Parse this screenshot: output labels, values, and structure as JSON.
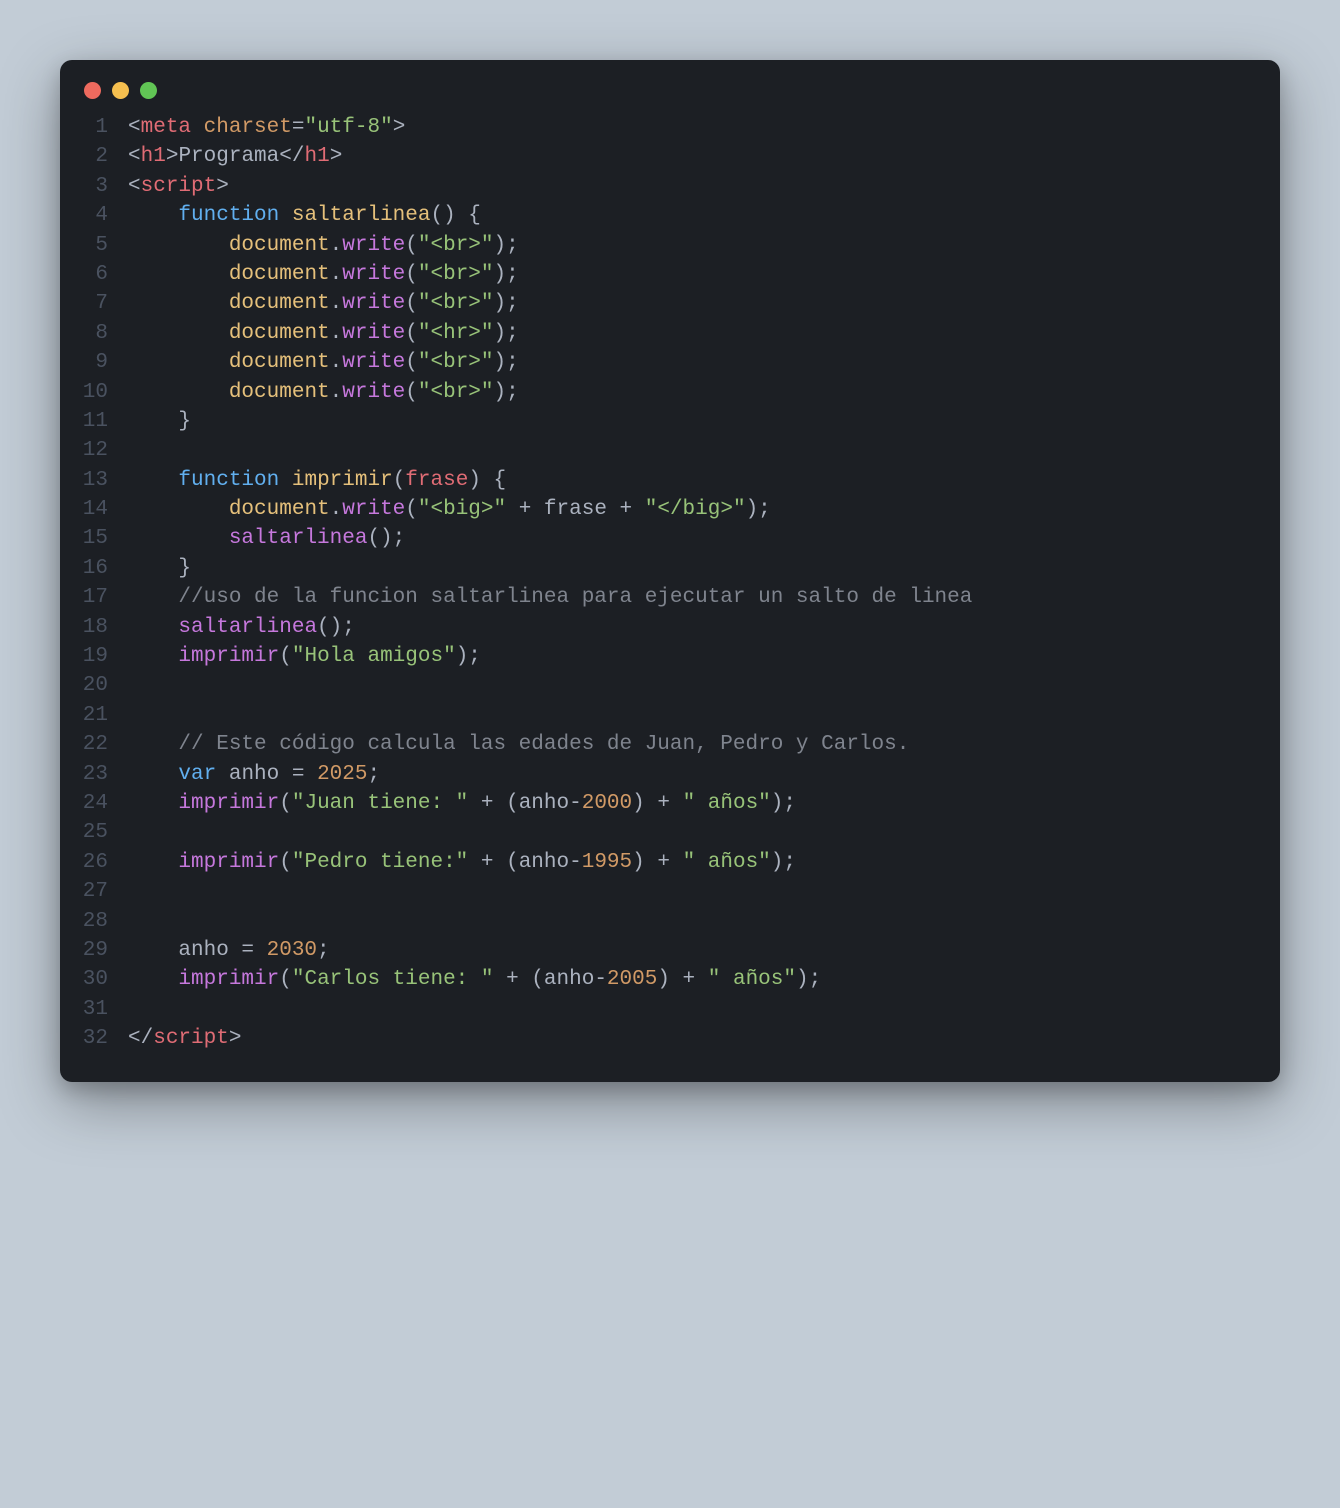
{
  "window": {
    "dots": [
      "red",
      "yellow",
      "green"
    ]
  },
  "colors": {
    "bg": "#1c1f24",
    "gutter": "#4a5260",
    "default": "#abb2bf",
    "tag": "#e06c75",
    "attr": "#d19a66",
    "string": "#98c379",
    "keyword": "#61afef",
    "func": "#e5c07b",
    "call": "#c678dd",
    "number": "#d19a66",
    "comment": "#7f848e"
  },
  "code": {
    "lines": [
      {
        "n": 1,
        "tokens": [
          {
            "t": "<",
            "c": "punc"
          },
          {
            "t": "meta",
            "c": "tag"
          },
          {
            "t": " ",
            "c": "punc"
          },
          {
            "t": "charset",
            "c": "attr"
          },
          {
            "t": "=",
            "c": "punc"
          },
          {
            "t": "\"utf-8\"",
            "c": "str"
          },
          {
            "t": ">",
            "c": "punc"
          }
        ]
      },
      {
        "n": 2,
        "tokens": [
          {
            "t": "<",
            "c": "punc"
          },
          {
            "t": "h1",
            "c": "tag"
          },
          {
            "t": ">",
            "c": "punc"
          },
          {
            "t": "Programa",
            "c": "text"
          },
          {
            "t": "</",
            "c": "punc"
          },
          {
            "t": "h1",
            "c": "tag"
          },
          {
            "t": ">",
            "c": "punc"
          }
        ]
      },
      {
        "n": 3,
        "tokens": [
          {
            "t": "<",
            "c": "punc"
          },
          {
            "t": "script",
            "c": "tag"
          },
          {
            "t": ">",
            "c": "punc"
          }
        ]
      },
      {
        "n": 4,
        "tokens": [
          {
            "t": "    ",
            "c": "punc"
          },
          {
            "t": "function",
            "c": "key"
          },
          {
            "t": " ",
            "c": "punc"
          },
          {
            "t": "saltarlinea",
            "c": "fn"
          },
          {
            "t": "() {",
            "c": "punc"
          }
        ]
      },
      {
        "n": 5,
        "tokens": [
          {
            "t": "        ",
            "c": "punc"
          },
          {
            "t": "document",
            "c": "prop"
          },
          {
            "t": ".",
            "c": "punc"
          },
          {
            "t": "write",
            "c": "call"
          },
          {
            "t": "(",
            "c": "punc"
          },
          {
            "t": "\"<br>\"",
            "c": "str"
          },
          {
            "t": ");",
            "c": "punc"
          }
        ]
      },
      {
        "n": 6,
        "tokens": [
          {
            "t": "        ",
            "c": "punc"
          },
          {
            "t": "document",
            "c": "prop"
          },
          {
            "t": ".",
            "c": "punc"
          },
          {
            "t": "write",
            "c": "call"
          },
          {
            "t": "(",
            "c": "punc"
          },
          {
            "t": "\"<br>\"",
            "c": "str"
          },
          {
            "t": ");",
            "c": "punc"
          }
        ]
      },
      {
        "n": 7,
        "tokens": [
          {
            "t": "        ",
            "c": "punc"
          },
          {
            "t": "document",
            "c": "prop"
          },
          {
            "t": ".",
            "c": "punc"
          },
          {
            "t": "write",
            "c": "call"
          },
          {
            "t": "(",
            "c": "punc"
          },
          {
            "t": "\"<br>\"",
            "c": "str"
          },
          {
            "t": ");",
            "c": "punc"
          }
        ]
      },
      {
        "n": 8,
        "tokens": [
          {
            "t": "        ",
            "c": "punc"
          },
          {
            "t": "document",
            "c": "prop"
          },
          {
            "t": ".",
            "c": "punc"
          },
          {
            "t": "write",
            "c": "call"
          },
          {
            "t": "(",
            "c": "punc"
          },
          {
            "t": "\"<hr>\"",
            "c": "str"
          },
          {
            "t": ");",
            "c": "punc"
          }
        ]
      },
      {
        "n": 9,
        "tokens": [
          {
            "t": "        ",
            "c": "punc"
          },
          {
            "t": "document",
            "c": "prop"
          },
          {
            "t": ".",
            "c": "punc"
          },
          {
            "t": "write",
            "c": "call"
          },
          {
            "t": "(",
            "c": "punc"
          },
          {
            "t": "\"<br>\"",
            "c": "str"
          },
          {
            "t": ");",
            "c": "punc"
          }
        ]
      },
      {
        "n": 10,
        "tokens": [
          {
            "t": "        ",
            "c": "punc"
          },
          {
            "t": "document",
            "c": "prop"
          },
          {
            "t": ".",
            "c": "punc"
          },
          {
            "t": "write",
            "c": "call"
          },
          {
            "t": "(",
            "c": "punc"
          },
          {
            "t": "\"<br>\"",
            "c": "str"
          },
          {
            "t": ");",
            "c": "punc"
          }
        ]
      },
      {
        "n": 11,
        "tokens": [
          {
            "t": "    }",
            "c": "punc"
          }
        ]
      },
      {
        "n": 12,
        "tokens": []
      },
      {
        "n": 13,
        "tokens": [
          {
            "t": "    ",
            "c": "punc"
          },
          {
            "t": "function",
            "c": "key"
          },
          {
            "t": " ",
            "c": "punc"
          },
          {
            "t": "imprimir",
            "c": "fn"
          },
          {
            "t": "(",
            "c": "punc"
          },
          {
            "t": "frase",
            "c": "param"
          },
          {
            "t": ") {",
            "c": "punc"
          }
        ]
      },
      {
        "n": 14,
        "tokens": [
          {
            "t": "        ",
            "c": "punc"
          },
          {
            "t": "document",
            "c": "prop"
          },
          {
            "t": ".",
            "c": "punc"
          },
          {
            "t": "write",
            "c": "call"
          },
          {
            "t": "(",
            "c": "punc"
          },
          {
            "t": "\"<big>\"",
            "c": "str"
          },
          {
            "t": " + ",
            "c": "op"
          },
          {
            "t": "frase",
            "c": "var"
          },
          {
            "t": " + ",
            "c": "op"
          },
          {
            "t": "\"</big>\"",
            "c": "str"
          },
          {
            "t": ");",
            "c": "punc"
          }
        ]
      },
      {
        "n": 15,
        "tokens": [
          {
            "t": "        ",
            "c": "punc"
          },
          {
            "t": "saltarlinea",
            "c": "call"
          },
          {
            "t": "();",
            "c": "punc"
          }
        ]
      },
      {
        "n": 16,
        "tokens": [
          {
            "t": "    }",
            "c": "punc"
          }
        ]
      },
      {
        "n": 17,
        "tokens": [
          {
            "t": "    ",
            "c": "punc"
          },
          {
            "t": "//uso de la funcion saltarlinea para ejecutar un salto de linea",
            "c": "comm"
          }
        ]
      },
      {
        "n": 18,
        "tokens": [
          {
            "t": "    ",
            "c": "punc"
          },
          {
            "t": "saltarlinea",
            "c": "call"
          },
          {
            "t": "();",
            "c": "punc"
          }
        ]
      },
      {
        "n": 19,
        "tokens": [
          {
            "t": "    ",
            "c": "punc"
          },
          {
            "t": "imprimir",
            "c": "call"
          },
          {
            "t": "(",
            "c": "punc"
          },
          {
            "t": "\"Hola amigos\"",
            "c": "str"
          },
          {
            "t": ");",
            "c": "punc"
          }
        ]
      },
      {
        "n": 20,
        "tokens": []
      },
      {
        "n": 21,
        "tokens": []
      },
      {
        "n": 22,
        "tokens": [
          {
            "t": "    ",
            "c": "punc"
          },
          {
            "t": "// Este código calcula las edades de Juan, Pedro y Carlos.",
            "c": "comm"
          }
        ]
      },
      {
        "n": 23,
        "tokens": [
          {
            "t": "    ",
            "c": "punc"
          },
          {
            "t": "var",
            "c": "key"
          },
          {
            "t": " anho = ",
            "c": "punc"
          },
          {
            "t": "2025",
            "c": "num"
          },
          {
            "t": ";",
            "c": "punc"
          }
        ]
      },
      {
        "n": 24,
        "tokens": [
          {
            "t": "    ",
            "c": "punc"
          },
          {
            "t": "imprimir",
            "c": "call"
          },
          {
            "t": "(",
            "c": "punc"
          },
          {
            "t": "\"Juan tiene: \"",
            "c": "str"
          },
          {
            "t": " + (anho-",
            "c": "punc"
          },
          {
            "t": "2000",
            "c": "num"
          },
          {
            "t": ") + ",
            "c": "punc"
          },
          {
            "t": "\" años\"",
            "c": "str"
          },
          {
            "t": ");",
            "c": "punc"
          }
        ]
      },
      {
        "n": 25,
        "tokens": []
      },
      {
        "n": 26,
        "tokens": [
          {
            "t": "    ",
            "c": "punc"
          },
          {
            "t": "imprimir",
            "c": "call"
          },
          {
            "t": "(",
            "c": "punc"
          },
          {
            "t": "\"Pedro tiene:\"",
            "c": "str"
          },
          {
            "t": " + (anho-",
            "c": "punc"
          },
          {
            "t": "1995",
            "c": "num"
          },
          {
            "t": ") + ",
            "c": "punc"
          },
          {
            "t": "\" años\"",
            "c": "str"
          },
          {
            "t": ");",
            "c": "punc"
          }
        ]
      },
      {
        "n": 27,
        "tokens": []
      },
      {
        "n": 28,
        "tokens": []
      },
      {
        "n": 29,
        "tokens": [
          {
            "t": "    anho = ",
            "c": "punc"
          },
          {
            "t": "2030",
            "c": "num"
          },
          {
            "t": ";",
            "c": "punc"
          }
        ]
      },
      {
        "n": 30,
        "tokens": [
          {
            "t": "    ",
            "c": "punc"
          },
          {
            "t": "imprimir",
            "c": "call"
          },
          {
            "t": "(",
            "c": "punc"
          },
          {
            "t": "\"Carlos tiene: \"",
            "c": "str"
          },
          {
            "t": " + (anho-",
            "c": "punc"
          },
          {
            "t": "2005",
            "c": "num"
          },
          {
            "t": ") + ",
            "c": "punc"
          },
          {
            "t": "\" años\"",
            "c": "str"
          },
          {
            "t": ");",
            "c": "punc"
          }
        ]
      },
      {
        "n": 31,
        "tokens": []
      },
      {
        "n": 32,
        "tokens": [
          {
            "t": "</",
            "c": "punc"
          },
          {
            "t": "script",
            "c": "tag"
          },
          {
            "t": ">",
            "c": "punc"
          }
        ]
      }
    ]
  }
}
